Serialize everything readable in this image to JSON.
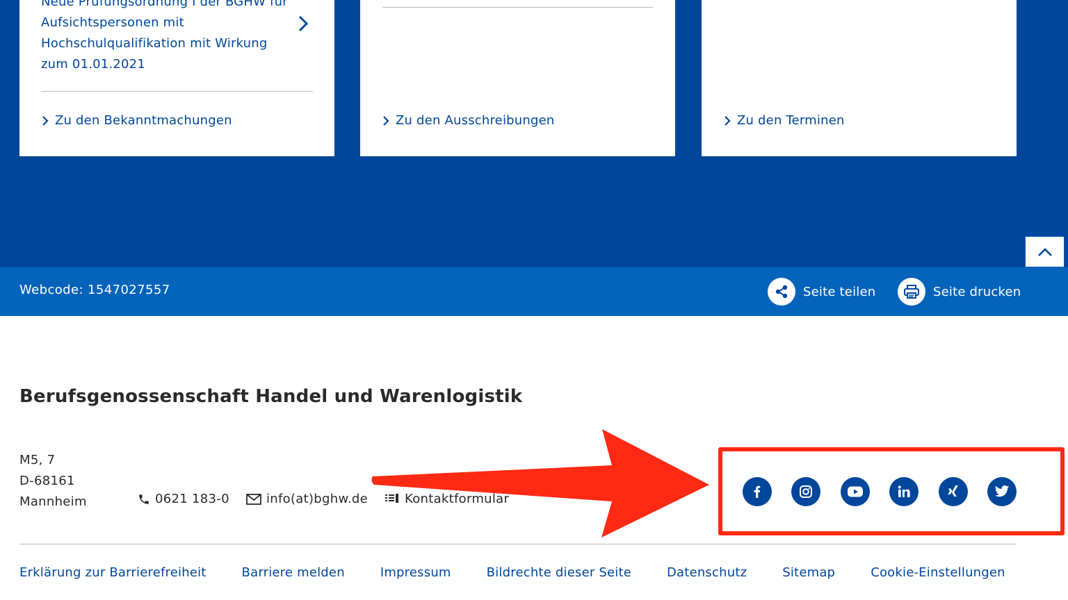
{
  "cards": [
    {
      "item_text": "Neue Prüfungsordnung I der BGHW für Aufsichtspersonen mit Hochschulqualifikation mit Wirkung zum 01.01.2021",
      "link": "Zu den Bekanntmachungen"
    },
    {
      "link": "Zu den Ausschreibungen"
    },
    {
      "link": "Zu den Terminen"
    }
  ],
  "toolbar": {
    "webcode": "Webcode: 1547027557",
    "share": "Seite teilen",
    "print": "Seite drucken"
  },
  "footer": {
    "org_title": "Berufsgenossenschaft Handel und Warenlogistik",
    "address": [
      "M5, 7",
      "D-68161",
      "Mannheim"
    ],
    "phone": "0621 183-0",
    "email": "info(at)bghw.de",
    "contact_form": "Kontaktformular",
    "social": [
      "facebook-icon",
      "instagram-icon",
      "youtube-icon",
      "linkedin-icon",
      "xing-icon",
      "twitter-icon"
    ],
    "links": [
      "Erklärung zur Barrierefreiheit",
      "Barriere melden",
      "Impressum",
      "Bildrechte dieser Seite",
      "Datenschutz",
      "Sitemap",
      "Cookie-Einstellungen"
    ]
  },
  "colors": {
    "brand_blue": "#00479b",
    "toolbar_blue": "#0464bb",
    "highlight_red": "#ff2a14"
  }
}
